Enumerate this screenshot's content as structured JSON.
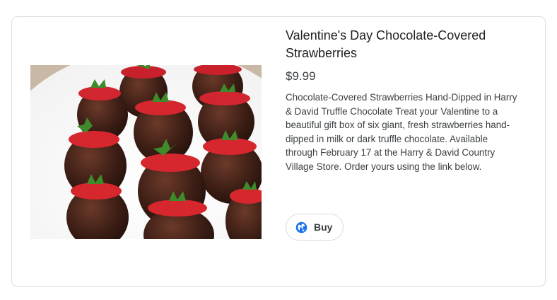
{
  "product": {
    "title": "Valentine's Day Chocolate-Covered Strawberries",
    "price": "$9.99",
    "description": "Chocolate-Covered Strawberries Hand-Dipped in Harry & David Truffle Chocolate Treat your Valentine to a beautiful gift box of six giant, fresh strawberries hand-dipped in milk or dark truffle chocolate. Available through February 17 at the Harry & David Country Village Store. Order yours using the link below.",
    "image_icon": "product-photo"
  },
  "actions": {
    "buy_label": "Buy",
    "buy_icon": "globe-icon",
    "accent_color": "#1a73e8"
  }
}
